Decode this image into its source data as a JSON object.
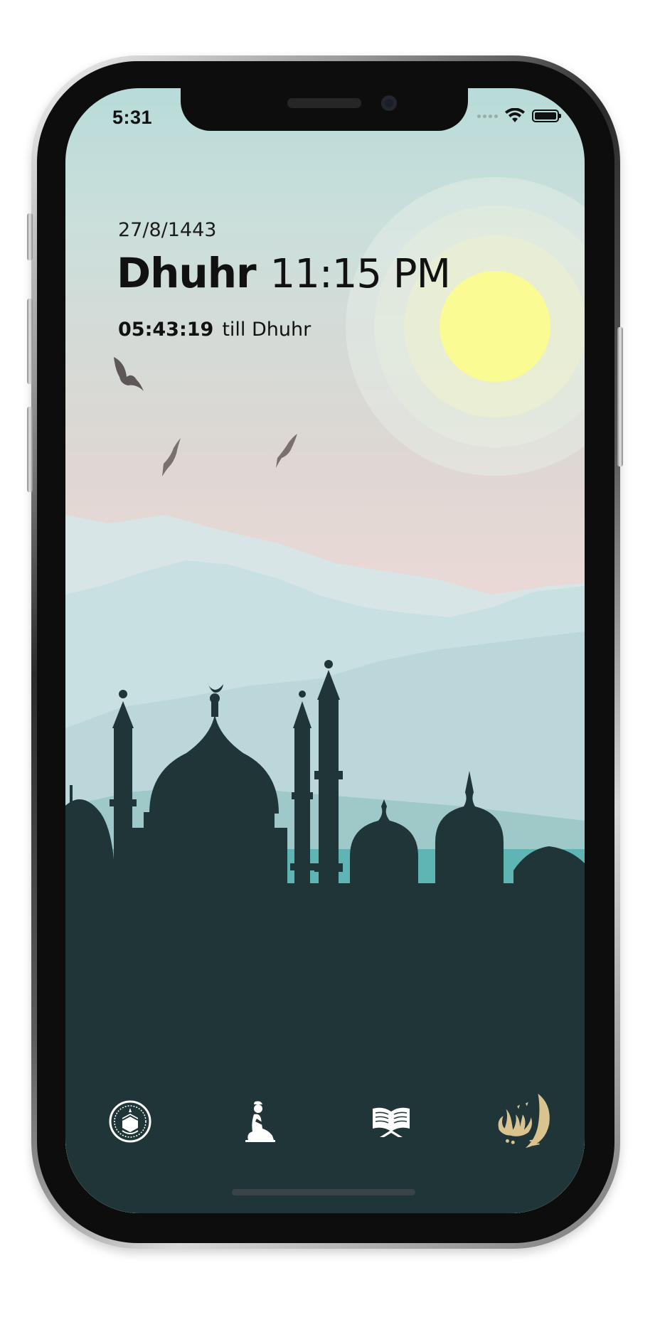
{
  "status_bar": {
    "time": "5:31"
  },
  "prayer_card": {
    "hijri_date": "27/8/1443",
    "prayer_name": "Dhuhr",
    "prayer_time": "11:15 PM",
    "countdown": "05:43:19",
    "countdown_suffix": "till Dhuhr"
  },
  "bottom_nav": {
    "items": [
      {
        "icon": "kaaba-icon"
      },
      {
        "icon": "praying-person-icon"
      },
      {
        "icon": "quran-book-icon"
      },
      {
        "icon": "islami-calligraphy-logo"
      }
    ]
  },
  "colors": {
    "sun": "#fbfb94",
    "silhouette": "#1f3538",
    "logo_gold": "#d9c48f",
    "sky_top": "#b8dbd9",
    "sky_pink": "#ead8d6"
  }
}
